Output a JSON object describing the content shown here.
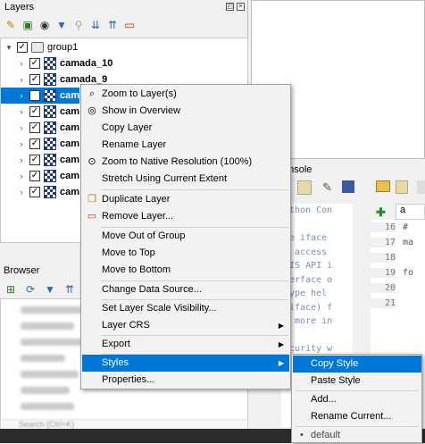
{
  "layers_panel": {
    "title": "Layers",
    "float_icon": "restore-icon",
    "close_icon": "close-icon",
    "toolbar_icons": [
      "style-icon",
      "add-group-icon",
      "eye-icon",
      "filter-icon",
      "filter-legend-icon",
      "expand-all-icon",
      "collapse-all-icon",
      "remove-layer-icon"
    ],
    "tree": {
      "group_name": "group1",
      "layers": [
        "camada_10",
        "camada_9",
        "cam",
        "cam",
        "cam",
        "cam",
        "cam",
        "cam",
        "cam"
      ]
    }
  },
  "console_panel": {
    "title": "onsole",
    "code_lines": [
      "ython Con",
      "",
      "se iface",
      "o access",
      "SIS API i",
      "terface o",
      "Type hel",
      "(iface) f",
      "r more in",
      "",
      "ecurity w"
    ],
    "tab_label": "a",
    "editor_line_numbers": [
      "16",
      "17",
      "18",
      "19",
      "20",
      "21"
    ],
    "editor_code": [
      "#",
      "ma",
      "",
      "fo",
      "",
      ""
    ]
  },
  "browser_panel": {
    "title": "Browser",
    "search_placeholder": "Search (Ctrl+K)"
  },
  "context_menu": {
    "items": [
      {
        "label": "Zoom to Layer(s)",
        "icon": "zoom-layer-icon"
      },
      {
        "label": "Show in Overview",
        "icon": "overview-icon"
      },
      {
        "label": "Copy Layer",
        "icon": ""
      },
      {
        "label": "Rename Layer",
        "icon": ""
      },
      {
        "label": "Zoom to Native Resolution (100%)",
        "icon": "zoom-native-icon"
      },
      {
        "label": "Stretch Using Current Extent",
        "icon": ""
      },
      {
        "label": "Duplicate Layer",
        "icon": "duplicate-icon"
      },
      {
        "label": "Remove Layer...",
        "icon": "remove-icon"
      },
      {
        "label": "Move Out of Group",
        "icon": ""
      },
      {
        "label": "Move to Top",
        "icon": ""
      },
      {
        "label": "Move to Bottom",
        "icon": ""
      },
      {
        "label": "Change Data Source...",
        "icon": ""
      },
      {
        "label": "Set Layer Scale Visibility...",
        "icon": ""
      },
      {
        "label": "Layer CRS",
        "icon": ""
      },
      {
        "label": "Export",
        "icon": ""
      },
      {
        "label": "Styles",
        "icon": ""
      },
      {
        "label": "Properties...",
        "icon": ""
      }
    ]
  },
  "styles_submenu": {
    "items": [
      "Copy Style",
      "Paste Style",
      "Add...",
      "Rename Current..."
    ],
    "current_style": "default",
    "current_marker": "•"
  },
  "colors": {
    "highlight": "#0078d7",
    "menu_bg": "#f2f2f2"
  }
}
